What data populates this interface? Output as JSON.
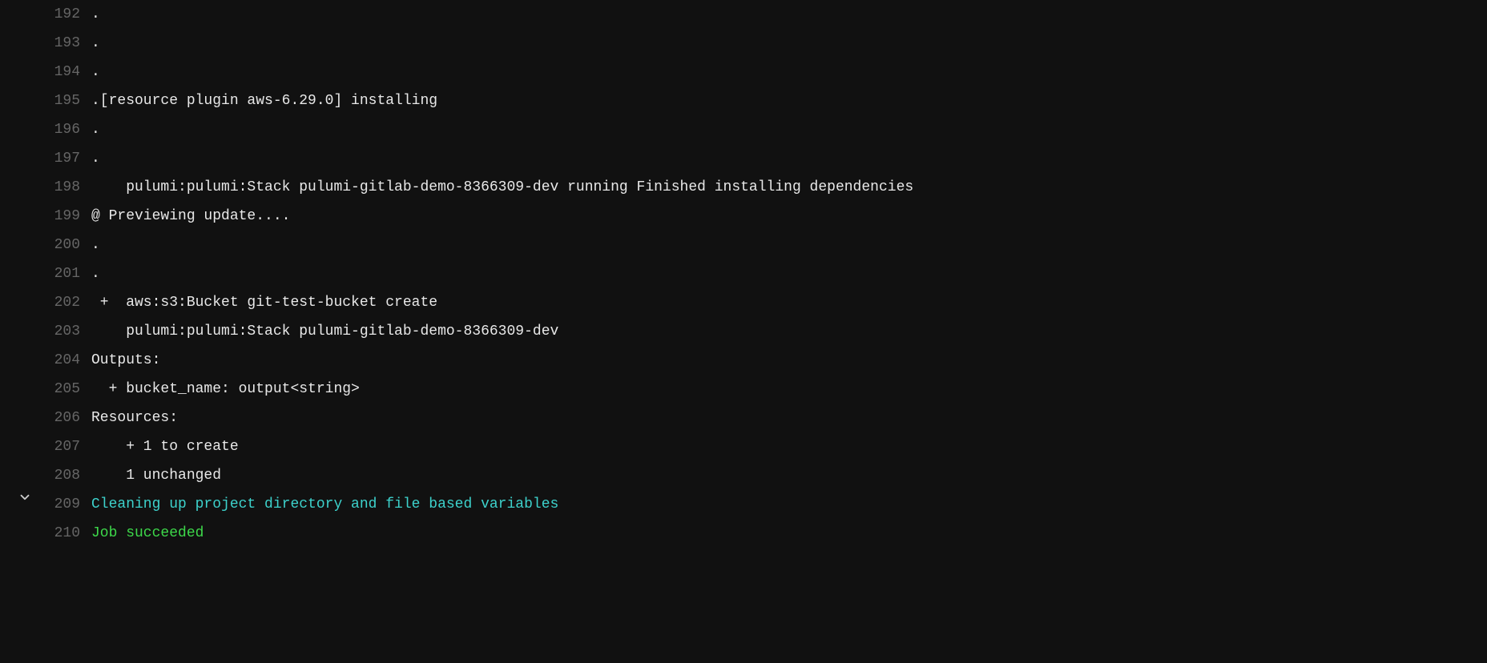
{
  "lines": [
    {
      "num": "192",
      "text": ".",
      "class": "",
      "collapsible": false
    },
    {
      "num": "193",
      "text": ".",
      "class": "",
      "collapsible": false
    },
    {
      "num": "194",
      "text": ".",
      "class": "",
      "collapsible": false
    },
    {
      "num": "195",
      "text": ".[resource plugin aws-6.29.0] installing",
      "class": "",
      "collapsible": false
    },
    {
      "num": "196",
      "text": ".",
      "class": "",
      "collapsible": false
    },
    {
      "num": "197",
      "text": ".",
      "class": "",
      "collapsible": false
    },
    {
      "num": "198",
      "text": "    pulumi:pulumi:Stack pulumi-gitlab-demo-8366309-dev running Finished installing dependencies",
      "class": "",
      "collapsible": false
    },
    {
      "num": "199",
      "text": "@ Previewing update....",
      "class": "",
      "collapsible": false
    },
    {
      "num": "200",
      "text": ".",
      "class": "",
      "collapsible": false
    },
    {
      "num": "201",
      "text": ".",
      "class": "",
      "collapsible": false
    },
    {
      "num": "202",
      "text": " +  aws:s3:Bucket git-test-bucket create",
      "class": "",
      "collapsible": false
    },
    {
      "num": "203",
      "text": "    pulumi:pulumi:Stack pulumi-gitlab-demo-8366309-dev",
      "class": "",
      "collapsible": false
    },
    {
      "num": "204",
      "text": "Outputs:",
      "class": "",
      "collapsible": false
    },
    {
      "num": "205",
      "text": "  + bucket_name: output<string>",
      "class": "",
      "collapsible": false
    },
    {
      "num": "206",
      "text": "Resources:",
      "class": "",
      "collapsible": false
    },
    {
      "num": "207",
      "text": "    + 1 to create",
      "class": "",
      "collapsible": false
    },
    {
      "num": "208",
      "text": "    1 unchanged",
      "class": "",
      "collapsible": false
    },
    {
      "num": "209",
      "text": "Cleaning up project directory and file based variables",
      "class": "teal",
      "collapsible": true
    },
    {
      "num": "210",
      "text": "Job succeeded",
      "class": "green",
      "collapsible": false
    }
  ]
}
